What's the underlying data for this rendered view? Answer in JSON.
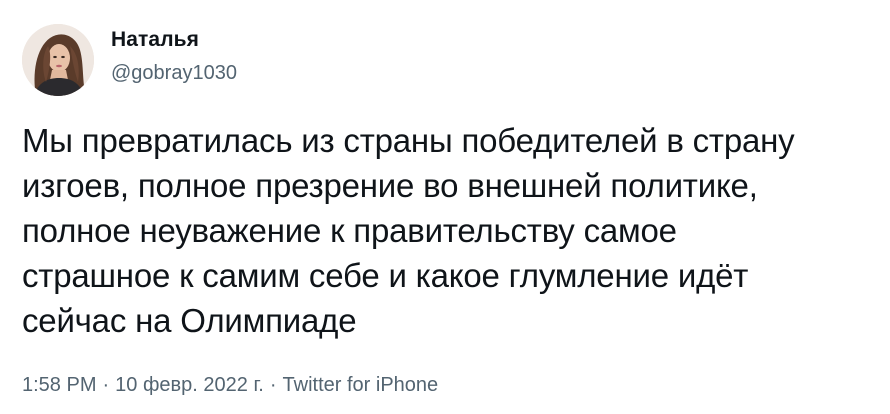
{
  "author": {
    "display_name": "Наталья",
    "handle": "@gobray1030",
    "avatar_icon": "user-avatar-photo"
  },
  "tweet": {
    "text": "Мы превратилась из страны победителей в страну\nизгоев, полное презрение во внешней политике,\nполное неуважение к правительству самое\nстрашное к самим себе и какое глумление идёт\nсейчас на Олимпиаде"
  },
  "meta": {
    "time": "1:58 PM",
    "separator": "·",
    "date": "10 февр. 2022 г.",
    "source": "Twitter for iPhone"
  },
  "colors": {
    "text": "#0f1419",
    "secondary": "#536471",
    "background": "#ffffff"
  }
}
